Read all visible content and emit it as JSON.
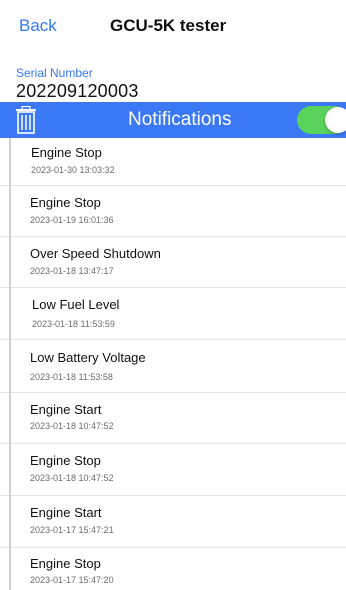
{
  "nav": {
    "back_label": "Back",
    "title": "GCU-5K tester"
  },
  "serial": {
    "label": "Serial Number",
    "value": "202209120003"
  },
  "notifications": {
    "title": "Notifications",
    "toggle_on": true,
    "bar_color": "#3a78f6",
    "toggle_color": "#5ad35c",
    "items": [
      {
        "title": "Engine Stop",
        "time": "2023-01-30 13:03:32"
      },
      {
        "title": "Engine Stop",
        "time": "2023-01-19 16:01:36"
      },
      {
        "title": "Over Speed Shutdown",
        "time": "2023-01-18 13:47:17"
      },
      {
        "title": "Low Fuel Level",
        "time": "2023-01-18 11:53:59"
      },
      {
        "title": "Low Battery Voltage",
        "time": "2023-01-18 11:53:58"
      },
      {
        "title": "Engine Start",
        "time": "2023-01-18 10:47:52"
      },
      {
        "title": "Engine Stop",
        "time": "2023-01-18 10:47:52"
      },
      {
        "title": "Engine Start",
        "time": "2023-01-17 15:47:21"
      },
      {
        "title": "Engine Stop",
        "time": "2023-01-17 15:47:20"
      }
    ]
  },
  "icons": {
    "trash": "trash-icon"
  }
}
